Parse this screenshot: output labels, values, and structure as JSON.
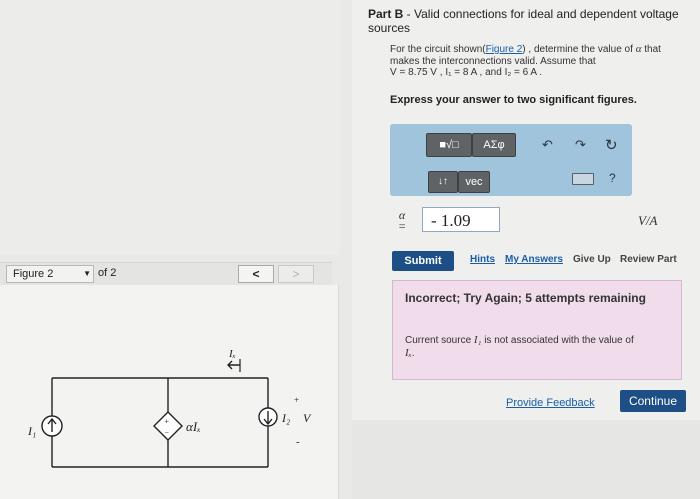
{
  "part": {
    "label": "Part B",
    "title": " - Valid connections for ideal and dependent voltage sources"
  },
  "problem": {
    "text_a": "For the circuit shown(",
    "figure_link": "Figure 2",
    "text_b": ") , determine the value of ",
    "alpha": "α",
    "text_c": " that makes the interconnections valid. Assume that",
    "given": "V = 8.75 V ,  I₁ = 8 A , and I₂ = 6 A ."
  },
  "instruction": "Express your answer to two significant figures.",
  "toolbar": {
    "templates_label": "■√□",
    "greek_label": "ΑΣφ",
    "sort_label": "↓↑",
    "vec_label": "vec",
    "undo_icon": "↶",
    "redo_icon": "↷",
    "reset_icon": "↻",
    "help_label": "?"
  },
  "answer": {
    "label_symbol": "α",
    "label_equals": "=",
    "value": "- 1.09",
    "unit": "V/A"
  },
  "actions": {
    "submit": "Submit",
    "hints": "Hints",
    "my_answers": "My Answers",
    "give_up": "Give Up",
    "review_part": "Review Part"
  },
  "feedback": {
    "title": "Incorrect; Try Again; 5 attempts remaining",
    "message_a": "Current source ",
    "message_i1": "I₁",
    "message_b": " is not associated with the value of",
    "message_ix": "Iₓ",
    "message_end": "."
  },
  "footer": {
    "provide_feedback": "Provide Feedback",
    "continue": "Continue"
  },
  "figure": {
    "selected": "Figure 2",
    "of_label": "of 2",
    "prev_icon": "<",
    "next_icon": ">",
    "labels": {
      "i1": "I₁",
      "dependent": "αIₓ",
      "i2": "I₂",
      "v": "V",
      "plus": "+",
      "minus": "-",
      "ix": "Iₓ",
      "source_plus": "+",
      "source_minus": "−"
    }
  }
}
